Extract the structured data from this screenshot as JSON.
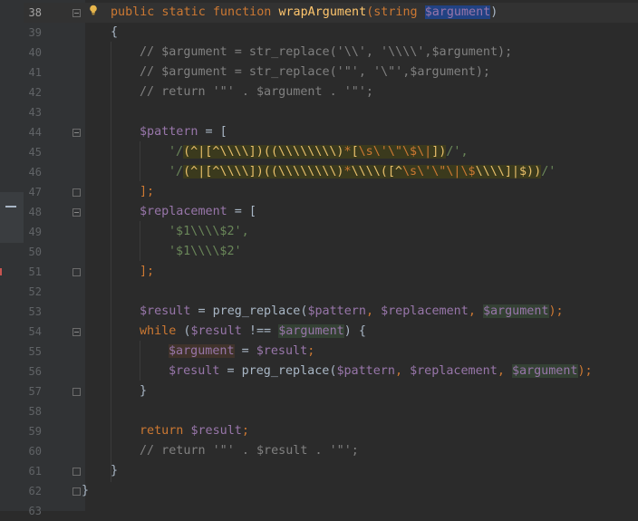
{
  "editor": {
    "lines": [
      {
        "n": "38"
      },
      {
        "n": "39"
      },
      {
        "n": "40"
      },
      {
        "n": "41"
      },
      {
        "n": "42"
      },
      {
        "n": "43"
      },
      {
        "n": "44"
      },
      {
        "n": "45"
      },
      {
        "n": "46"
      },
      {
        "n": "47"
      },
      {
        "n": "48"
      },
      {
        "n": "49"
      },
      {
        "n": "50"
      },
      {
        "n": "51"
      },
      {
        "n": "52"
      },
      {
        "n": "53"
      },
      {
        "n": "54"
      },
      {
        "n": "55"
      },
      {
        "n": "56"
      },
      {
        "n": "57"
      },
      {
        "n": "58"
      },
      {
        "n": "59"
      },
      {
        "n": "60"
      },
      {
        "n": "61"
      },
      {
        "n": "62"
      },
      {
        "n": "63"
      }
    ],
    "code": {
      "l38": {
        "a": "public static function ",
        "b": "wrapArgument",
        "c": "(string ",
        "d": "$argument",
        ")": ")"
      },
      "l39": {
        "a": "{"
      },
      "l40": {
        "a": "// $argument = str_replace('\\\\', '\\\\\\\\',$argument);"
      },
      "l41": {
        "a": "// $argument = str_replace('\"', '\\\"',$argument);"
      },
      "l42": {
        "a": "// return '\"' . $argument . '\"';"
      },
      "l44": {
        "a": "$pattern",
        " b": " = ["
      },
      "l45": {
        "q1": "'/",
        "rx": "(^|[^\\\\\\\\])((\\\\\\\\\\\\\\\\)",
        "e1": "*",
        "rx2": "[",
        "e2": "\\s",
        "e3": "\\'\\\"",
        "e4": "\\$\\|",
        "rx3": "])",
        "q2": "/',"
      },
      "l46": {
        "q1": "'/",
        "rx": "(^|[^\\\\\\\\])((\\\\\\\\\\\\\\\\)",
        "e1": "*",
        "rx2": "\\\\\\\\([^",
        "e2": "\\s",
        "e3": "\\'\\\"",
        "e4": "\\|\\$",
        "rx3": "\\\\\\\\]|$))",
        "q2": "/'"
      },
      "l47": {
        "a": "];"
      },
      "l48": {
        "a": "$replacement",
        " b": " = ["
      },
      "l49": {
        "a": "'$1\\\\\\\\$2',"
      },
      "l50": {
        "a": "'$1\\\\\\\\$2'"
      },
      "l51": {
        "a": "];"
      },
      "l53": {
        "v1": "$result",
        "op": " = ",
        "f": "preg_replace(",
        "v2": "$pattern",
        ", ": ", ",
        "v3": "$replacement",
        "c2": ", ",
        "v4": "$argument",
        "end": ");"
      },
      "l54": {
        "kw": "while ",
        "p": "(",
        "v1": "$result",
        "op": " !== ",
        "v2": "$argument",
        "end": ") {"
      },
      "l55": {
        "v1": "$argument",
        "op": " = ",
        "v2": "$result",
        "end": ";"
      },
      "l56": {
        "v1": "$result",
        "op": " = ",
        "f": "preg_replace(",
        "v2": "$pattern",
        ", ": ", ",
        "v3": "$replacement",
        "c2": ", ",
        "v4": "$argument",
        "end": ");"
      },
      "l57": {
        "a": "}"
      },
      "l59": {
        "kw": "return ",
        "v": "$result",
        "end": ";"
      },
      "l60": {
        "a": "// return '\"' . $result . '\"';"
      },
      "l61": {
        "a": "}"
      },
      "l62": {
        "a": "}"
      }
    }
  },
  "colors": {
    "background": "#2b2b2b",
    "keyword": "#cc7832",
    "function": "#ffc66d",
    "variable": "#9876aa",
    "string": "#6a8759",
    "comment": "#808080"
  },
  "icons": {
    "gutter_bulb": "lightbulb-icon",
    "fold": "fold-marker-icon"
  }
}
